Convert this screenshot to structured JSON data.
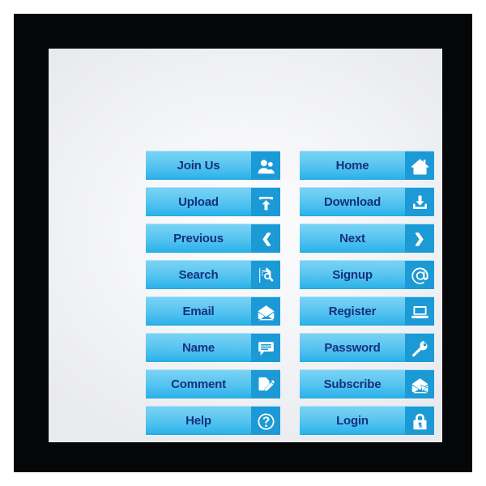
{
  "artwork": {
    "kind": "web-button-set",
    "frame_color": "#050608",
    "panel_color": "#f4f5f7",
    "button_body_top_color": "#79d3f4",
    "button_body_bottom_color": "#24a9e0",
    "button_icon_panel_color": "#1c9ad6",
    "button_label_color": "#15317e",
    "icon_glyph_color": "#ffffff"
  },
  "columns": [
    {
      "name": "left-column",
      "buttons": [
        {
          "label": "Join Us",
          "icon": "users-icon"
        },
        {
          "label": "Upload",
          "icon": "upload-arrow-icon"
        },
        {
          "label": "Previous",
          "icon": "chevron-left-icon"
        },
        {
          "label": "Search",
          "icon": "document-magnifier-icon"
        },
        {
          "label": "Email",
          "icon": "open-envelope-icon"
        },
        {
          "label": "Name",
          "icon": "speech-bubble-icon"
        },
        {
          "label": "Comment",
          "icon": "document-pencil-icon"
        },
        {
          "label": "Help",
          "icon": "question-circle-icon"
        }
      ]
    },
    {
      "name": "right-column",
      "buttons": [
        {
          "label": "Home",
          "icon": "house-icon"
        },
        {
          "label": "Download",
          "icon": "download-tray-icon"
        },
        {
          "label": "Next",
          "icon": "chevron-right-icon"
        },
        {
          "label": "Signup",
          "icon": "at-sign-icon"
        },
        {
          "label": "Register",
          "icon": "laptop-icon"
        },
        {
          "label": "Password",
          "icon": "key-icon"
        },
        {
          "label": "Subscribe",
          "icon": "envelope-cursor-icon"
        },
        {
          "label": "Login",
          "icon": "padlock-icon"
        }
      ]
    }
  ]
}
